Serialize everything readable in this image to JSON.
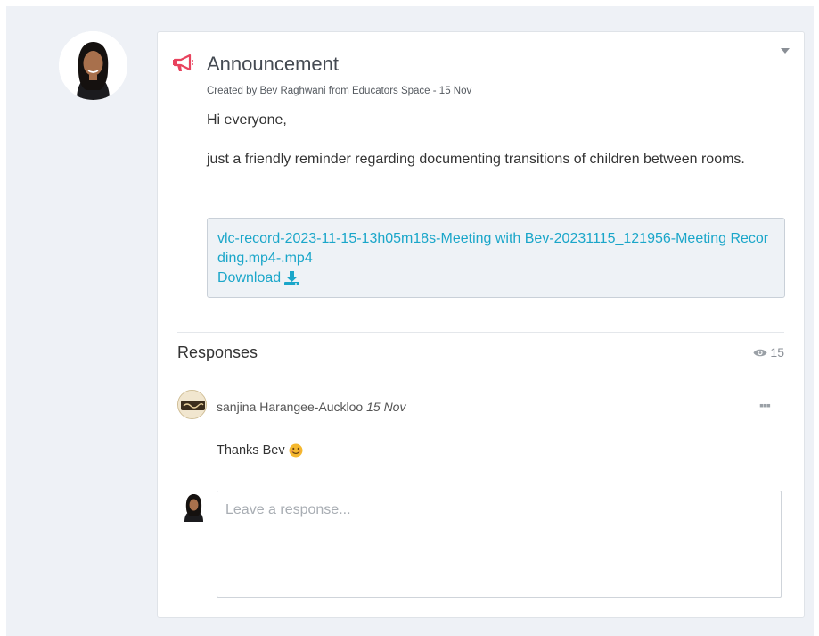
{
  "post": {
    "title": "Announcement",
    "meta": "Created by Bev Raghwani from Educators Space - 15 Nov",
    "body": [
      "Hi everyone,",
      "just a friendly reminder regarding documenting transitions of children between rooms."
    ],
    "attachment": {
      "filename": "vlc-record-2023-11-15-13h05m18s-Meeting with Bev-20231115_121956-Meeting Recording.mp4-.mp4",
      "download_label": "Download"
    }
  },
  "responses": {
    "heading": "Responses",
    "view_count": "15",
    "items": [
      {
        "author": "sanjina Harangee-Auckloo",
        "date": "15 Nov",
        "text": "Thanks Bev"
      }
    ],
    "input_placeholder": "Leave a response..."
  },
  "colors": {
    "accent_link": "#1aa6c9",
    "megaphone": "#e8435e",
    "page_background": "#eef1f6"
  },
  "icons": [
    "megaphone-icon",
    "download-icon",
    "eye-icon",
    "smile-emoji-icon",
    "more-dots-icon",
    "chevron-down-icon"
  ]
}
